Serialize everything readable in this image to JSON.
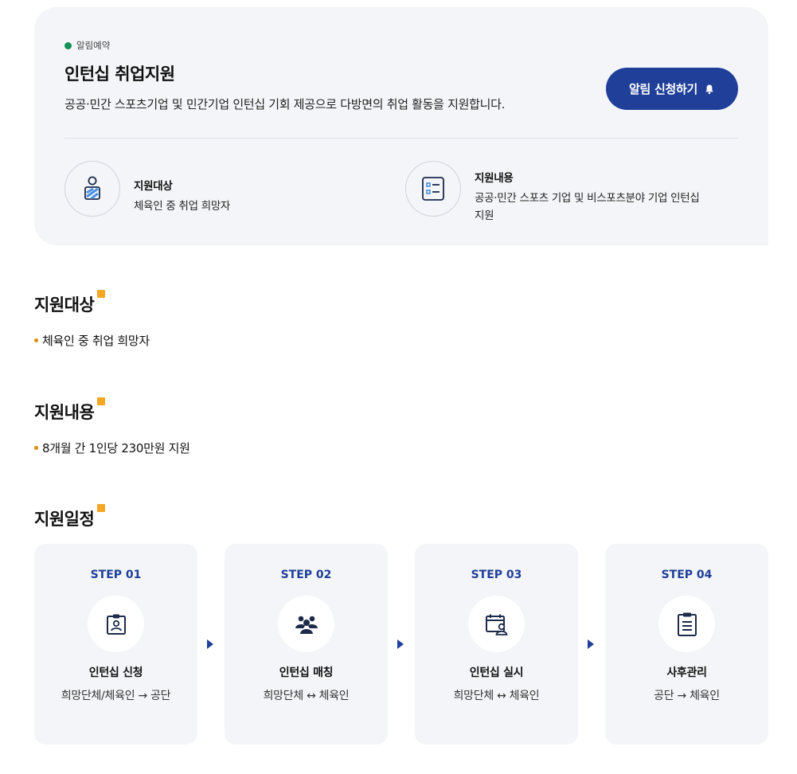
{
  "program": {
    "status": "알림예약",
    "title": "인턴십 취업지원",
    "description": "공공·민간 스포츠기업 및 민간기업 인턴십 기회 제공으로 다방면의 취업 활동을 지원합니다.",
    "notify_button": "알림 신청하기",
    "target": {
      "label": "지원대상",
      "value": "체육인 중 취업 희망자",
      "icon": "person-badge-icon"
    },
    "content": {
      "label": "지원내용",
      "value_line1": "공공·민간 스포츠 기업 및 비스포츠분야 기업 인턴십",
      "value_line2": "지원",
      "icon": "list-icon"
    }
  },
  "sections": {
    "target": {
      "title": "지원대상",
      "item": "체육인 중 취업 희망자"
    },
    "content": {
      "title": "지원내용",
      "item": "8개월 간 1인당 230만원 지원"
    },
    "schedule": {
      "title": "지원일정"
    }
  },
  "steps": [
    {
      "label": "STEP 01",
      "name": "인턴십 신청",
      "desc": "희망단체/체육인 → 공단",
      "icon": "id-card-icon"
    },
    {
      "label": "STEP 02",
      "name": "인턴십 매칭",
      "desc": "희망단체 ↔ 체육인",
      "icon": "group-icon"
    },
    {
      "label": "STEP 03",
      "name": "인턴십 실시",
      "desc": "희망단체 ↔ 체육인",
      "icon": "calendar-person-icon"
    },
    {
      "label": "STEP 04",
      "name": "사후관리",
      "desc": "공단 → 체육인",
      "icon": "clipboard-icon"
    }
  ],
  "colors": {
    "primary": "#1f3f99",
    "status_dot": "#109159",
    "accent": "#f5a623",
    "card_bg": "#f3f5f8"
  }
}
